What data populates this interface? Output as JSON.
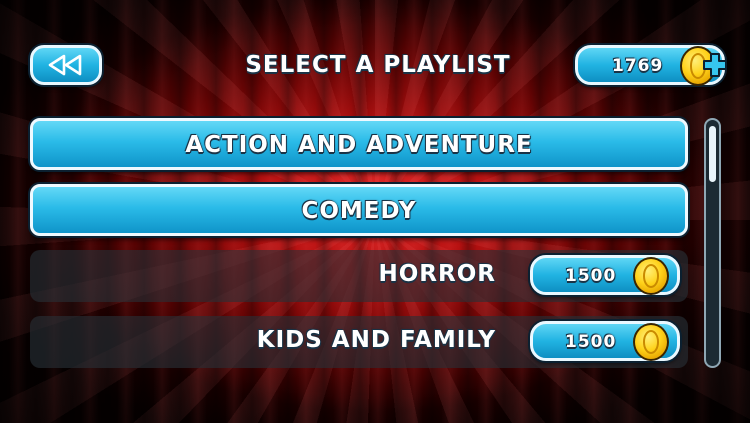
{
  "header": {
    "title": "SELECT A PLAYLIST",
    "back_icon": "rewind-icon",
    "coins": "1769",
    "coin_icon": "coin-icon",
    "add_icon": "plus-icon"
  },
  "playlists": [
    {
      "label": "ACTION AND ADVENTURE",
      "state": "unlocked"
    },
    {
      "label": "COMEDY",
      "state": "unlocked"
    },
    {
      "label": "HORROR",
      "state": "locked",
      "price": "1500"
    },
    {
      "label": "KIDS AND FAMILY",
      "state": "locked",
      "price": "1500"
    }
  ],
  "scroll": {
    "position": 0.0
  },
  "colors": {
    "button_blue": "#21b3e2",
    "button_border": "#e9f8ff",
    "coin_gold": "#ffd21a",
    "background_red": "#b51010"
  }
}
